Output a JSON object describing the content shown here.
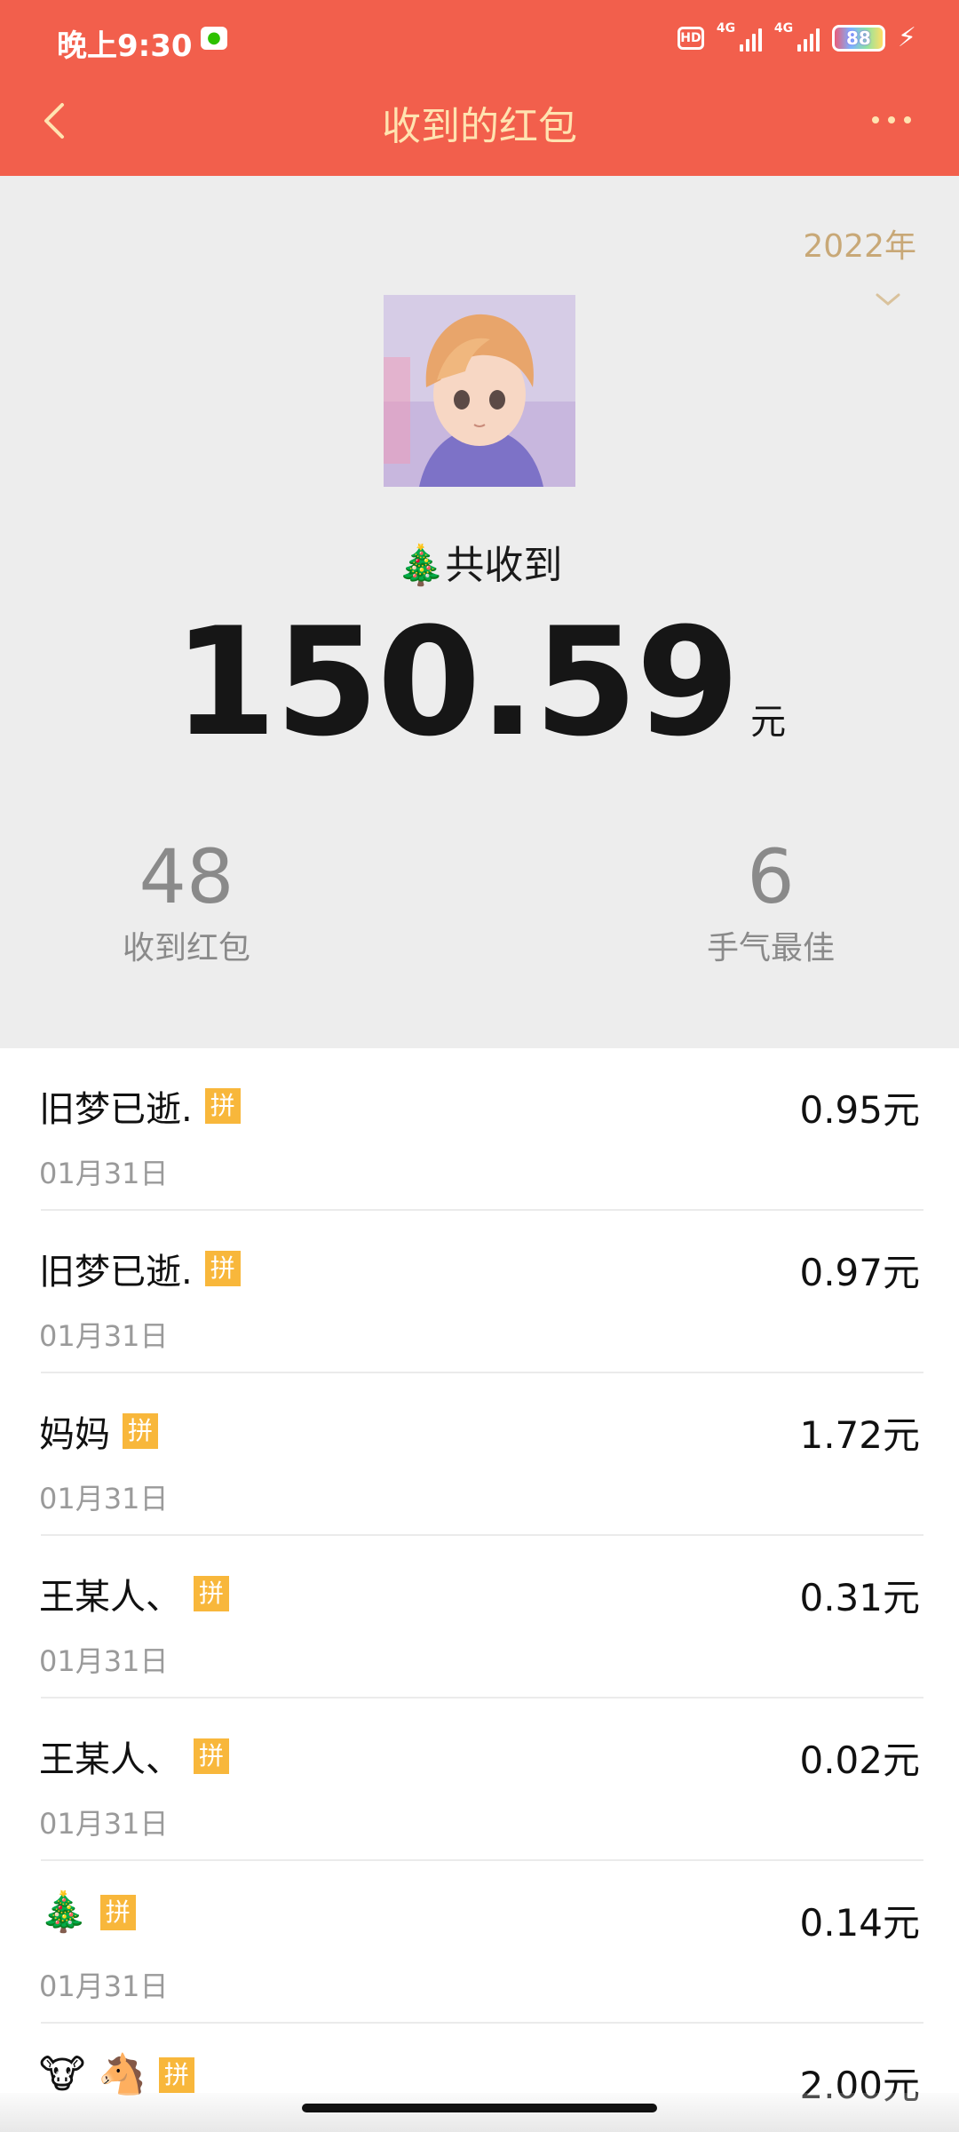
{
  "status_bar": {
    "time": "晚上9:30",
    "hd": "HD",
    "network_1": "4G",
    "network_2": "4G",
    "battery": "88"
  },
  "header": {
    "title": "收到的红包",
    "accent_color": "#f25f4c",
    "title_color": "#ffe3b0"
  },
  "summary": {
    "year": "2022年",
    "total_label": "共收到",
    "total_amount": "150.59",
    "total_unit": "元",
    "received_count": "48",
    "received_label": "收到红包",
    "best_luck_count": "6",
    "best_luck_label": "手气最佳"
  },
  "list": {
    "pin_badge": "拼",
    "items": [
      {
        "name": "旧梦已逝.",
        "date": "01月31日",
        "amount": "0.95元"
      },
      {
        "name": "旧梦已逝.",
        "date": "01月31日",
        "amount": "0.97元"
      },
      {
        "name": "妈妈",
        "date": "01月31日",
        "amount": "1.72元"
      },
      {
        "name": "王某人、",
        "date": "01月31日",
        "amount": "0.31元"
      },
      {
        "name": "王某人、",
        "date": "01月31日",
        "amount": "0.02元"
      },
      {
        "name": "🎄",
        "date": "01月31日",
        "amount": "0.14元"
      },
      {
        "name": "🐮 🐴",
        "date": "",
        "amount": "2.00元"
      }
    ]
  }
}
